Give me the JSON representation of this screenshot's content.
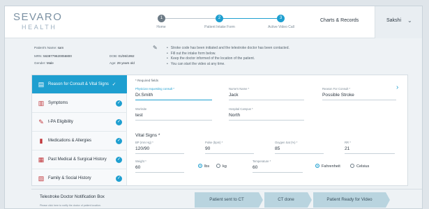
{
  "header": {
    "logo_line1": "SEVARO",
    "logo_line2": "HEALTH",
    "steps": [
      {
        "number": "1",
        "label": "Home",
        "state": "done"
      },
      {
        "number": "2",
        "label": "Patient Intake Form",
        "state": "active"
      },
      {
        "number": "3",
        "label": "Active Video Call",
        "state": "active"
      }
    ],
    "charts_link": "Charts & Records",
    "user_name": "Sakshi",
    "user_chevron": "⌄"
  },
  "patient": {
    "name_label": "Patient's Name:",
    "name_value": "sam",
    "mrn_label": "MRN:",
    "mrn_value": "5638779620056800",
    "dob_label": "DOB:",
    "dob_value": "01/06/1992",
    "gender_label": "Gender:",
    "gender_value": "Male",
    "age_label": "Age:",
    "age_value": "29 years old",
    "edit_icon": "✎"
  },
  "notices": [
    "Stroke code has been initiated and the telestroke doctor has been contacted.",
    "Fill out the intake form below.",
    "Keep the doctor informed of the location of the patient.",
    "You can start the video at any time."
  ],
  "nav": {
    "items": [
      {
        "label": "Reason for Consult & Vital Signs",
        "icon": "clipboard-icon",
        "glyph": "▤",
        "active": true,
        "check": "✓"
      },
      {
        "label": "Symptoms",
        "icon": "symptoms-list-icon",
        "glyph": "▥",
        "active": false,
        "check": "✓"
      },
      {
        "label": "t-PA Eligibility",
        "icon": "syringe-icon",
        "glyph": "✎",
        "active": false,
        "check": "✓"
      },
      {
        "label": "Medications & Allergies",
        "icon": "pill-bottle-icon",
        "glyph": "▮",
        "active": false,
        "check": "✓"
      },
      {
        "label": "Past Medical & Surgical History",
        "icon": "medical-history-icon",
        "glyph": "▦",
        "active": false,
        "check": "✓"
      },
      {
        "label": "Family & Social History",
        "icon": "family-icon",
        "glyph": "▧",
        "active": false,
        "check": "✓"
      }
    ]
  },
  "form": {
    "required_note": "* Required fields",
    "next_arrow": "›",
    "fields": {
      "physician": {
        "label": "Physician requesting consult *",
        "value": "Dr.Smith"
      },
      "nurse": {
        "label": "Nurse's Name *",
        "value": "Jack"
      },
      "reason": {
        "label": "Reason For Consult *",
        "value": "Possible Stroke"
      },
      "worksite": {
        "label": "Worksite",
        "value": "test"
      },
      "campus": {
        "label": "Hospital Campus *",
        "value": "North"
      }
    },
    "vitals_title": "Vital Signs *",
    "vitals": {
      "bp": {
        "label": "BP (mm Hg) *",
        "value": "120/90"
      },
      "pulse": {
        "label": "Pulse (bpm) *",
        "value": "90"
      },
      "oxygen": {
        "label": "Oxygen Sat (%) *",
        "value": "85"
      },
      "rr": {
        "label": "RR *",
        "value": "21"
      },
      "weight": {
        "label": "Weight *",
        "value": "60"
      },
      "temperature": {
        "label": "Temperature *",
        "value": "60"
      }
    },
    "weight_units": [
      {
        "label": "lbs",
        "selected": true
      },
      {
        "label": "kg",
        "selected": false
      }
    ],
    "temp_units": [
      {
        "label": "Fahrenheit",
        "selected": true
      },
      {
        "label": "Celsius",
        "selected": false
      }
    ]
  },
  "footer": {
    "title": "Telestroke Doctor Notification Box",
    "subtitle": "Please click here to notify the doctor of patient location.",
    "buttons": [
      "Patient sent to CT",
      "CT done",
      "Patient Ready for Video"
    ]
  },
  "colors": {
    "accent": "#1e9fd0",
    "icon_red": "#c0353a",
    "footer_button": "#b9d4df"
  }
}
